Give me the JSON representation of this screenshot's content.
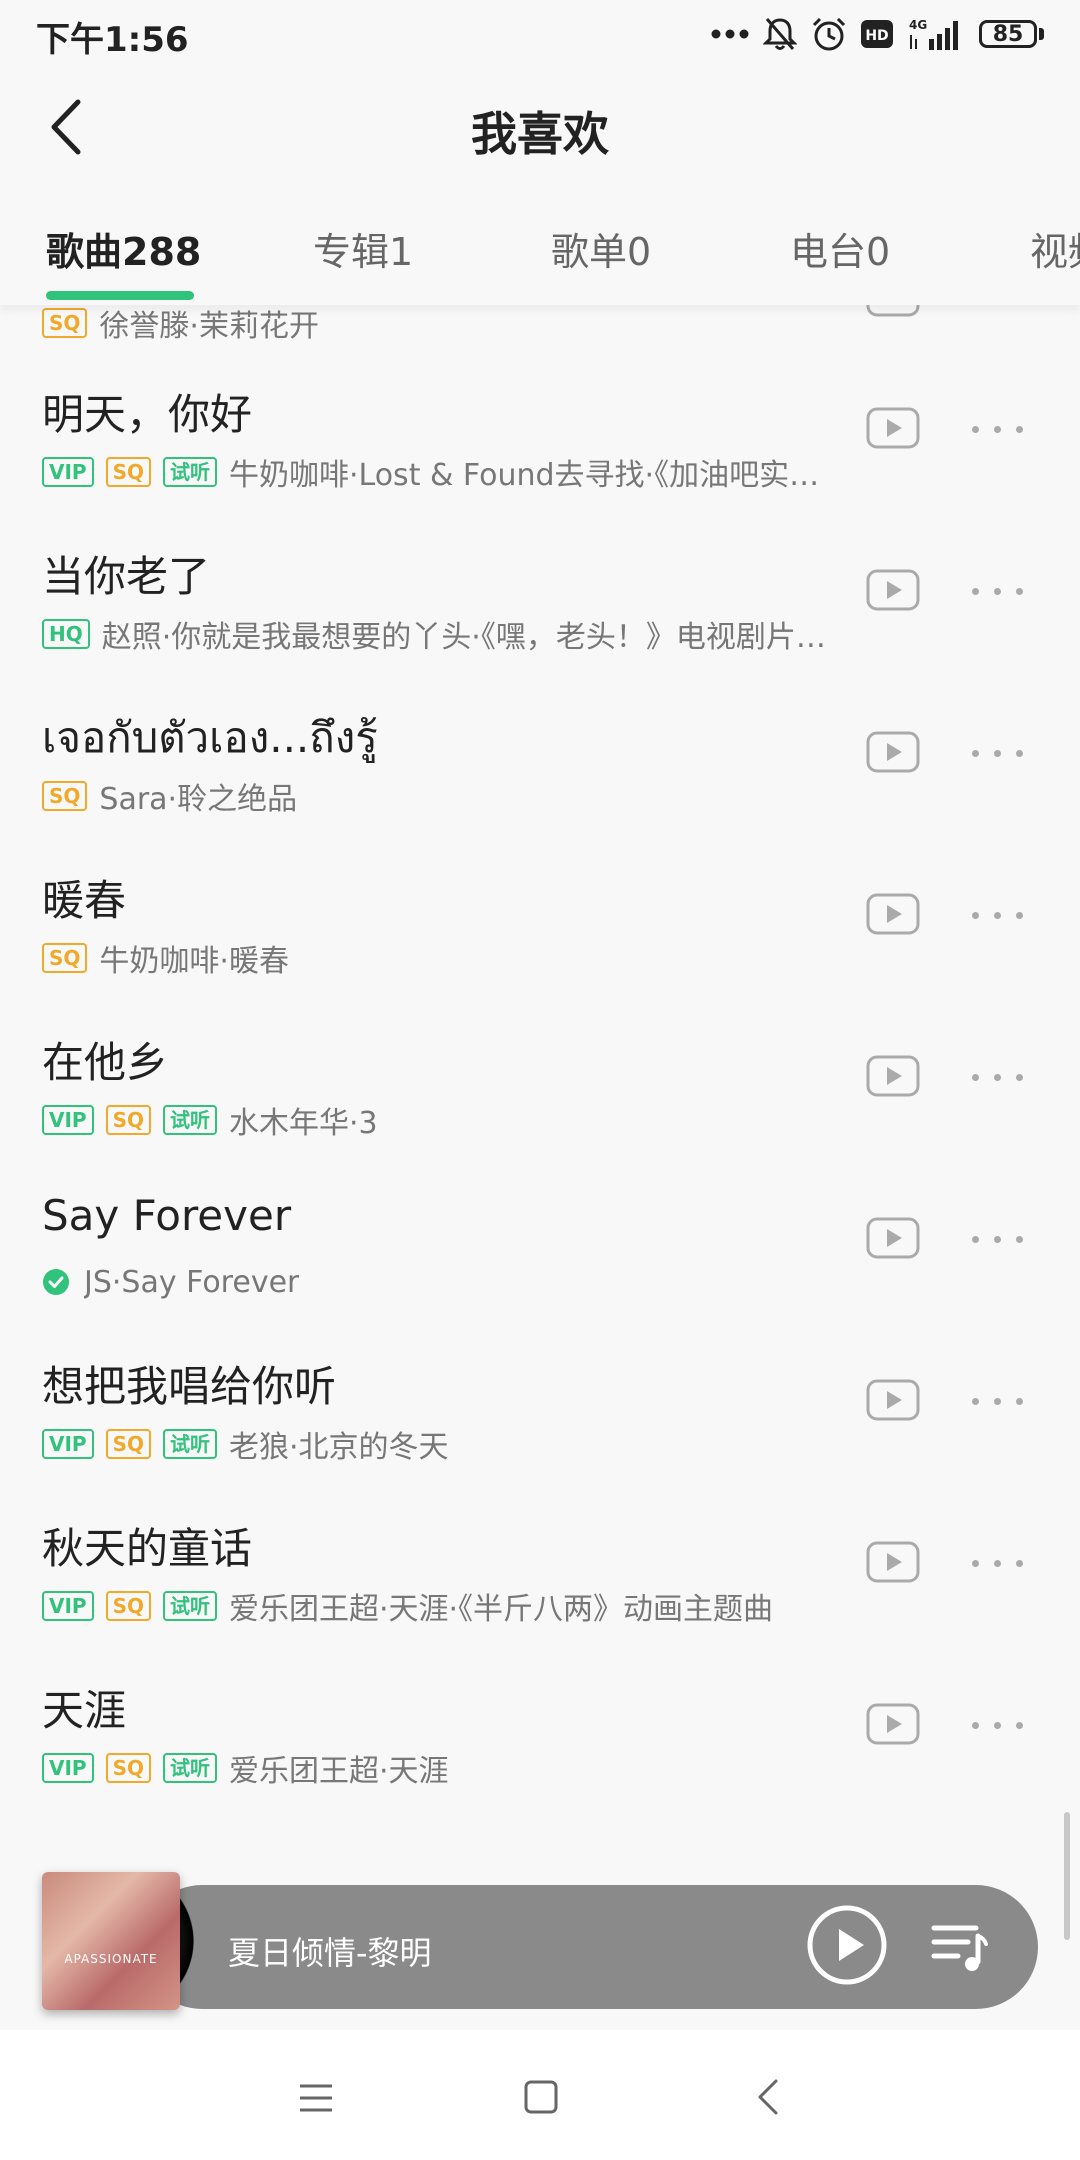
{
  "status_bar": {
    "time": "下午1:56",
    "network": "4G",
    "hd": "HD",
    "battery": "85"
  },
  "header": {
    "title": "我喜欢"
  },
  "tabs": [
    {
      "label": "歌曲288",
      "active": true
    },
    {
      "label": "专辑1"
    },
    {
      "label": "歌单0"
    },
    {
      "label": "电台0"
    },
    {
      "label": "视频"
    }
  ],
  "badges": {
    "vip": "VIP",
    "sq": "SQ",
    "hq": "HQ",
    "trial": "试听"
  },
  "partial_song": {
    "meta": "徐誉滕·茉莉花开"
  },
  "songs": [
    {
      "title": "明天，你好",
      "meta": "牛奶咖啡·Lost & Found去寻找·《加油吧实习生》"
    },
    {
      "title": "当你老了",
      "meta": "赵照·你就是我最想要的丫头·《嘿，老头！》电视剧片尾曲"
    },
    {
      "title": "เจอกับตัวเอง...ถึงรู้",
      "meta": "Sara·聆之绝品"
    },
    {
      "title": "暖春",
      "meta": "牛奶咖啡·暖春"
    },
    {
      "title": "在他乡",
      "meta": "水木年华·3"
    },
    {
      "title": "Say Forever",
      "meta": "JS·Say Forever"
    },
    {
      "title": "想把我唱给你听",
      "meta": "老狼·北京的冬天"
    },
    {
      "title": "秋天的童话",
      "meta": "爱乐团王超·天涯·《半斤八两》动画主题曲"
    },
    {
      "title": "天涯",
      "meta": "爱乐团王超·天涯"
    }
  ],
  "player": {
    "now_playing": "夏日倾情-黎明",
    "album_art_text": "APASSIONATE"
  },
  "colors": {
    "accent": "#31c27c",
    "sq": "#f0a92b"
  }
}
